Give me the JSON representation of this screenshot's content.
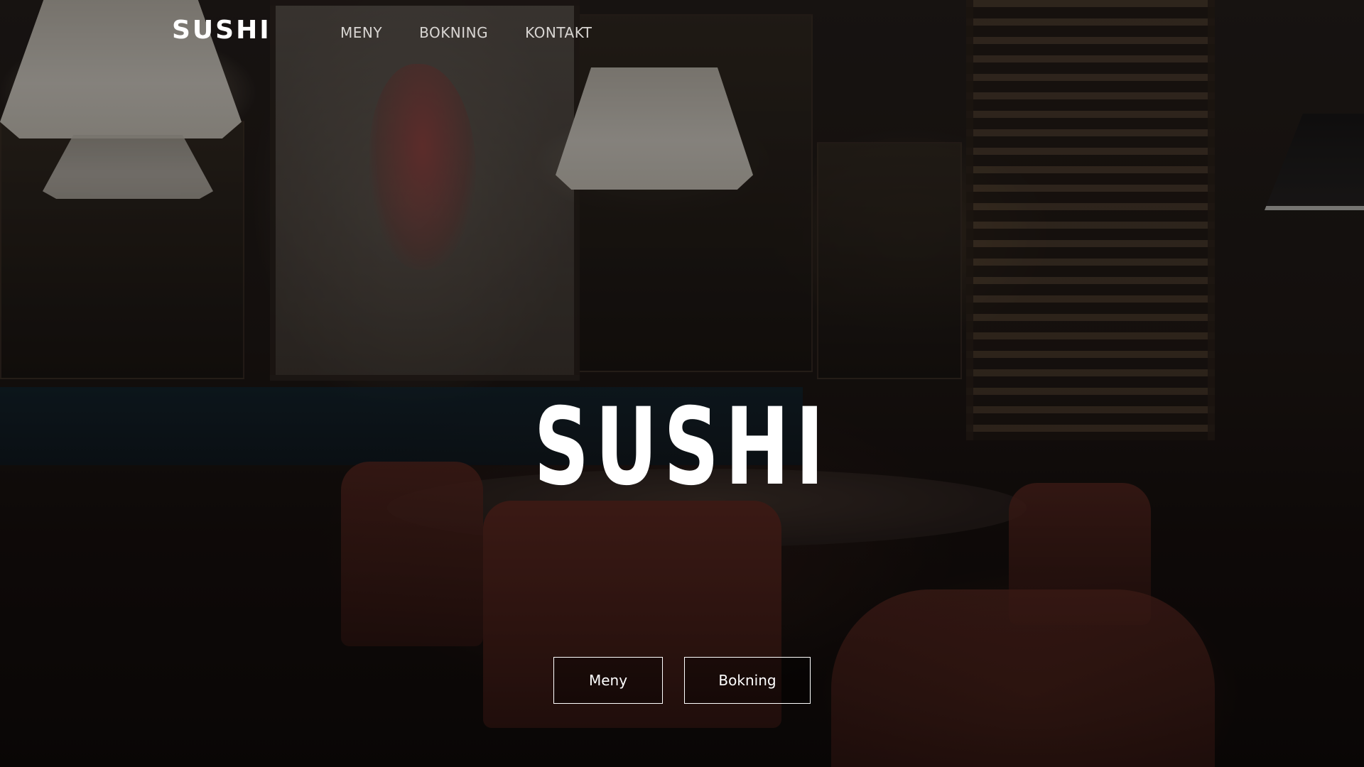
{
  "header": {
    "logo": "SUSHI",
    "nav": [
      {
        "label": "MENY"
      },
      {
        "label": "BOKNING"
      },
      {
        "label": "KONTAKT"
      }
    ]
  },
  "hero": {
    "title": "SUSHI",
    "buttons": {
      "menu_label": "Meny",
      "booking_label": "Bokning"
    }
  },
  "colors": {
    "text": "#ffffff",
    "nav_text": "#d9d6d3",
    "overlay": "rgba(0,0,0,0.45)"
  }
}
